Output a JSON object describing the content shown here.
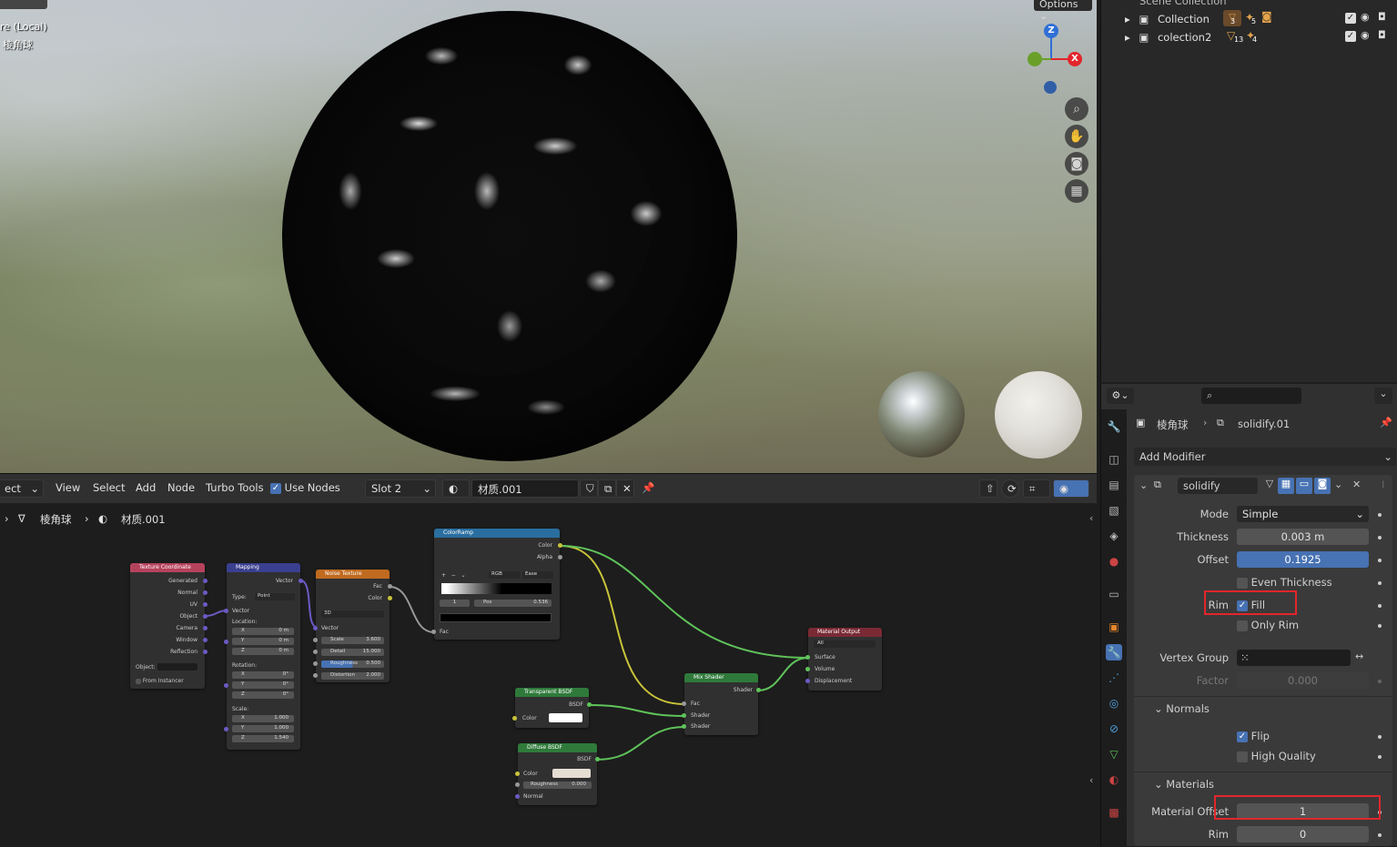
{
  "viewport": {
    "title_line1": "re (Local)",
    "title_line2": "棱角球",
    "options_label": "Options",
    "gizmo_z": "Z",
    "gizmo_x": "X"
  },
  "node_editor": {
    "header": {
      "select_mode": "ect",
      "menu_view": "View",
      "menu_select": "Select",
      "menu_add": "Add",
      "menu_node": "Node",
      "menu_turbo": "Turbo Tools",
      "use_nodes_label": "Use Nodes",
      "slot_value": "Slot 2",
      "material_name": "材质.001"
    },
    "breadcrumb": {
      "object": "棱角球",
      "material": "材质.001"
    },
    "nodes": {
      "texcoord": {
        "title": "Texture Coordinate",
        "outputs": [
          "Generated",
          "Normal",
          "UV",
          "Object",
          "Camera",
          "Window",
          "Reflection"
        ],
        "object_label": "Object:",
        "from_instancer": "From Instancer"
      },
      "mapping": {
        "title": "Mapping",
        "out_vector": "Vector",
        "type_label": "Type:",
        "type_value": "Point",
        "in_vector": "Vector",
        "location_label": "Location:",
        "loc": [
          [
            "X",
            "0 m"
          ],
          [
            "Y",
            "0 m"
          ],
          [
            "Z",
            "0 m"
          ]
        ],
        "rotation_label": "Rotation:",
        "rot": [
          [
            "X",
            "0°"
          ],
          [
            "Y",
            "0°"
          ],
          [
            "Z",
            "0°"
          ]
        ],
        "scale_label": "Scale:",
        "scl": [
          [
            "X",
            "1.000"
          ],
          [
            "Y",
            "1.000"
          ],
          [
            "Z",
            "1.540"
          ]
        ]
      },
      "noise": {
        "title": "Noise Texture",
        "out_fac": "Fac",
        "out_color": "Color",
        "dim": "3D",
        "in_vector": "Vector",
        "fields": [
          [
            "Scale",
            "3.600"
          ],
          [
            "Detail",
            "15.000"
          ],
          [
            "Roughness",
            "0.500"
          ],
          [
            "Distortion",
            "2.000"
          ]
        ]
      },
      "colorramp": {
        "title": "ColorRamp",
        "out_color": "Color",
        "out_alpha": "Alpha",
        "mode": "RGB",
        "interp": "Ease",
        "index": "1",
        "pos_label": "Pos",
        "pos_value": "0.536",
        "in_fac": "Fac"
      },
      "transparent": {
        "title": "Transparent BSDF",
        "out": "BSDF",
        "color_label": "Color"
      },
      "diffuse": {
        "title": "Diffuse BSDF",
        "out": "BSDF",
        "color_label": "Color",
        "roughness_label": "Roughness",
        "roughness_value": "0.000",
        "normal_label": "Normal"
      },
      "mix": {
        "title": "Mix Shader",
        "out": "Shader",
        "fac": "Fac",
        "shader1": "Shader",
        "shader2": "Shader"
      },
      "output": {
        "title": "Material Output",
        "target": "All",
        "surface": "Surface",
        "volume": "Volume",
        "displacement": "Displacement"
      }
    }
  },
  "outliner": {
    "root": "Scene Collection",
    "items": [
      {
        "name": "Collection",
        "count1": "3",
        "count2": "5"
      },
      {
        "name": "colection2",
        "count1": "13",
        "count2": "4"
      }
    ]
  },
  "properties": {
    "breadcrumb_object": "棱角球",
    "breadcrumb_modifier": "solidify.01",
    "add_modifier": "Add Modifier",
    "modifier_name": "solidify",
    "mode_label": "Mode",
    "mode_value": "Simple",
    "thickness_label": "Thickness",
    "thickness_value": "0.003 m",
    "offset_label": "Offset",
    "offset_value": "0.1925",
    "even_thickness_label": "Even Thickness",
    "rim_label": "Rim",
    "fill_label": "Fill",
    "only_rim_label": "Only Rim",
    "vertex_group_label": "Vertex Group",
    "factor_label": "Factor",
    "factor_value": "0.000",
    "normals_label": "Normals",
    "flip_label": "Flip",
    "high_quality_label": "High Quality",
    "materials_label": "Materials",
    "material_offset_label": "Material Offset",
    "material_offset_value": "1",
    "rim_mat_label": "Rim",
    "rim_mat_value": "0"
  },
  "colors": {
    "accent_blue": "#4772b3",
    "highlight_red": "#e2262c",
    "node_texture": "#b5425d",
    "node_vector": "#3a3f8f",
    "node_tex_orange": "#c06a1f",
    "node_converter": "#2a6ea0",
    "node_shader": "#2f7a3a",
    "node_output": "#7a2a35"
  }
}
